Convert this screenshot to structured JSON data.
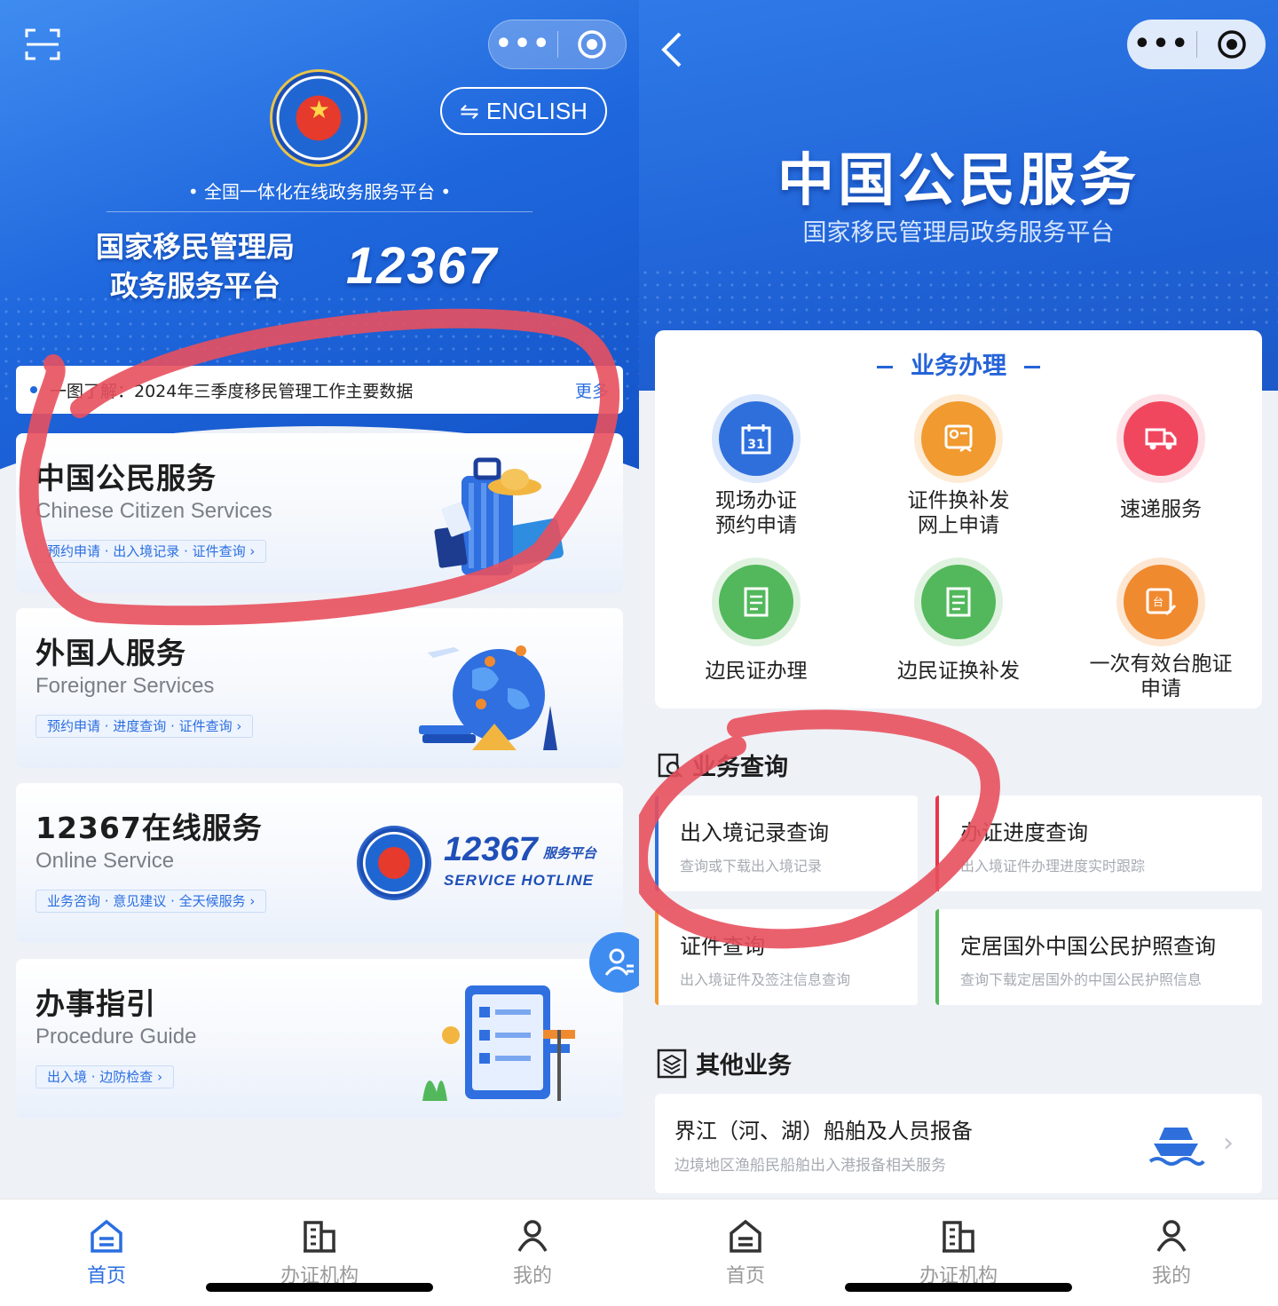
{
  "left": {
    "header": {
      "english_button": "ENGLISH",
      "platform_line": "• 全国一体化在线政务服务平台 •",
      "org_title_line1": "国家移民管理局",
      "org_title_line2": "政务服务平台",
      "hotline_number": "12367"
    },
    "notice": {
      "text": "一图了解：2024年三季度移民管理工作主要数据",
      "more": "更多"
    },
    "cards": [
      {
        "title": "中国公民服务",
        "subtitle": "Chinese Citizen Services",
        "tags": "预约申请 · 出入境记录 · 证件查询 ›"
      },
      {
        "title": "外国人服务",
        "subtitle": "Foreigner Services",
        "tags": "预约申请 · 进度查询 · 证件查询 ›"
      },
      {
        "title": "12367在线服务",
        "subtitle": "Online Service",
        "tags": "业务咨询 · 意见建议 · 全天候服务 ›",
        "logo_number": "12367",
        "logo_cn": "服务平台",
        "logo_en": "SERVICE HOTLINE"
      },
      {
        "title": "办事指引",
        "subtitle": "Procedure Guide",
        "tags": "出入境 · 边防检查 ›"
      }
    ],
    "tabbar": [
      {
        "label": "首页",
        "icon": "home-icon",
        "active": true
      },
      {
        "label": "办证机构",
        "icon": "building-icon",
        "active": false
      },
      {
        "label": "我的",
        "icon": "user-icon",
        "active": false
      }
    ]
  },
  "right": {
    "header": {
      "title": "中国公民服务",
      "subtitle": "国家移民管理局政务服务平台"
    },
    "business": {
      "heading": "业务办理",
      "items": [
        {
          "line1": "现场办证",
          "line2": "预约申请",
          "icon": "calendar-icon",
          "color": "#2e6fdc"
        },
        {
          "line1": "证件换补发",
          "line2": "网上申请",
          "icon": "id-card-icon",
          "color": "#f19a2f"
        },
        {
          "line1": "速递服务",
          "line2": "",
          "icon": "truck-icon",
          "color": "#f0475f"
        },
        {
          "line1": "边民证办理",
          "line2": "",
          "icon": "document-icon",
          "color": "#52b85b"
        },
        {
          "line1": "边民证换补发",
          "line2": "",
          "icon": "document-icon",
          "color": "#52b85b"
        },
        {
          "line1": "一次有效台胞证",
          "line2": "申请",
          "icon": "edit-card-icon",
          "color": "#f08a2f"
        }
      ]
    },
    "query": {
      "heading": "业务查询",
      "cards": [
        {
          "title": "出入境记录查询",
          "sub": "查询或下载出入境记录",
          "color": "#2e6fdc"
        },
        {
          "title": "办证进度查询",
          "sub": "出入境证件办理进度实时跟踪",
          "color": "#e8364d"
        },
        {
          "title": "证件查询",
          "sub": "出入境证件及签注信息查询",
          "color": "#f19a2f"
        },
        {
          "title": "定居国外中国公民护照查询",
          "sub": "查询下载定居国外的中国公民护照信息",
          "color": "#52b85b"
        }
      ]
    },
    "other": {
      "heading": "其他业务",
      "item_title": "界江（河、湖）船舶及人员报备",
      "item_sub": "边境地区渔船民船舶出入港报备相关服务"
    },
    "tabbar": [
      {
        "label": "首页",
        "icon": "home-icon",
        "active": false
      },
      {
        "label": "办证机构",
        "icon": "building-icon",
        "active": false
      },
      {
        "label": "我的",
        "icon": "user-icon",
        "active": false
      }
    ]
  },
  "colors": {
    "brand_blue": "#1f67dd",
    "link_blue": "#2a6ee0",
    "annotation_red": "#e8505e"
  }
}
